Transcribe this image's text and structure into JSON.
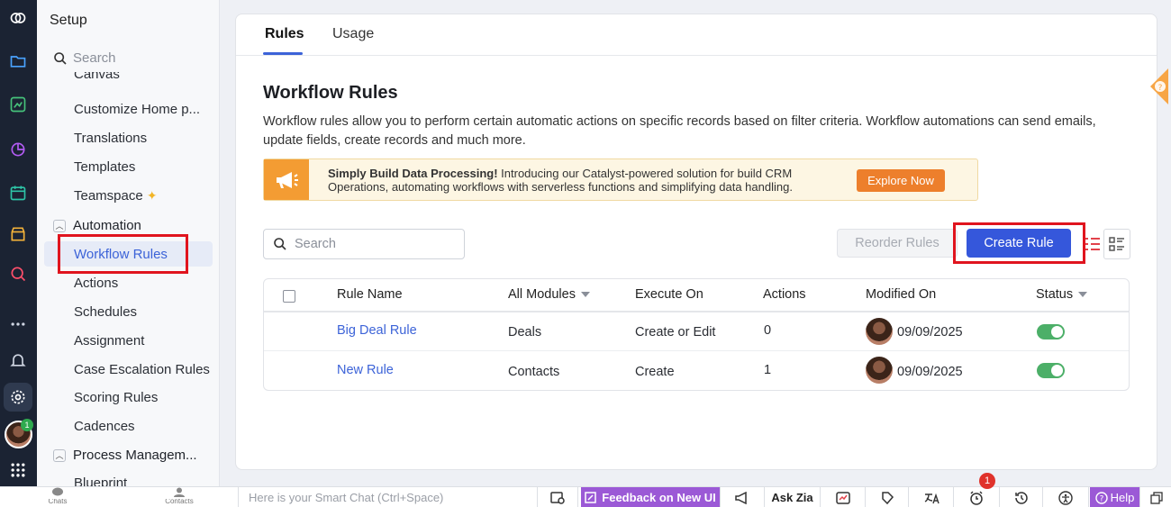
{
  "sidebar": {
    "title": "Setup",
    "search_placeholder": "Search",
    "items": [
      {
        "label": "Canvas"
      },
      {
        "label": "Customize Home p..."
      },
      {
        "label": "Translations"
      },
      {
        "label": "Templates"
      },
      {
        "label": "Teamspace"
      }
    ],
    "groups": [
      {
        "label": "Automation"
      },
      {
        "label": "Process Managem..."
      }
    ],
    "automation_items": [
      {
        "label": "Workflow Rules"
      },
      {
        "label": "Actions"
      },
      {
        "label": "Schedules"
      },
      {
        "label": "Assignment"
      },
      {
        "label": "Case Escalation Rules"
      },
      {
        "label": "Scoring Rules"
      },
      {
        "label": "Cadences"
      }
    ],
    "process_items": [
      {
        "label": "Blueprint"
      }
    ],
    "badge": "1"
  },
  "tabs": [
    {
      "label": "Rules"
    },
    {
      "label": "Usage"
    }
  ],
  "main": {
    "title": "Workflow Rules",
    "description": "Workflow rules allow you to perform certain automatic actions on specific records based on filter criteria. Workflow automations can send emails, update fields, create records and much more.",
    "banner": {
      "bold": "Simply Build Data Processing!",
      "text": " Introducing our Catalyst-powered solution for build CRM Operations, automating workflows with serverless functions and simplifying data handling.",
      "button": "Explore Now"
    },
    "search_placeholder": "Search",
    "reorder_label": "Reorder Rules",
    "create_label": "Create Rule"
  },
  "table": {
    "headers": {
      "name": "Rule Name",
      "module": "All Modules",
      "execute": "Execute On",
      "actions": "Actions",
      "modified": "Modified On",
      "status": "Status"
    },
    "rows": [
      {
        "name": "Big Deal Rule",
        "module": "Deals",
        "execute": "Create or Edit",
        "actions": "0",
        "modified": "09/09/2025",
        "status": "on"
      },
      {
        "name": "New Rule",
        "module": "Contacts",
        "execute": "Create",
        "actions": "1",
        "modified": "09/09/2025",
        "status": "on"
      }
    ]
  },
  "bottombar": {
    "chats": "Chats",
    "contacts": "Contacts",
    "smart_chat_placeholder": "Here is your Smart Chat (Ctrl+Space)",
    "feedback": "Feedback on New UI",
    "ask_zia": "Ask Zia",
    "help": "Help",
    "notif_count": "1"
  },
  "colors": {
    "accent": "#3557db",
    "link": "#3c63d8",
    "highlight_box": "#e0141e",
    "toggle_on": "#4caf68",
    "banner_button": "#ed7f2c",
    "purple": "#9b59d6"
  }
}
